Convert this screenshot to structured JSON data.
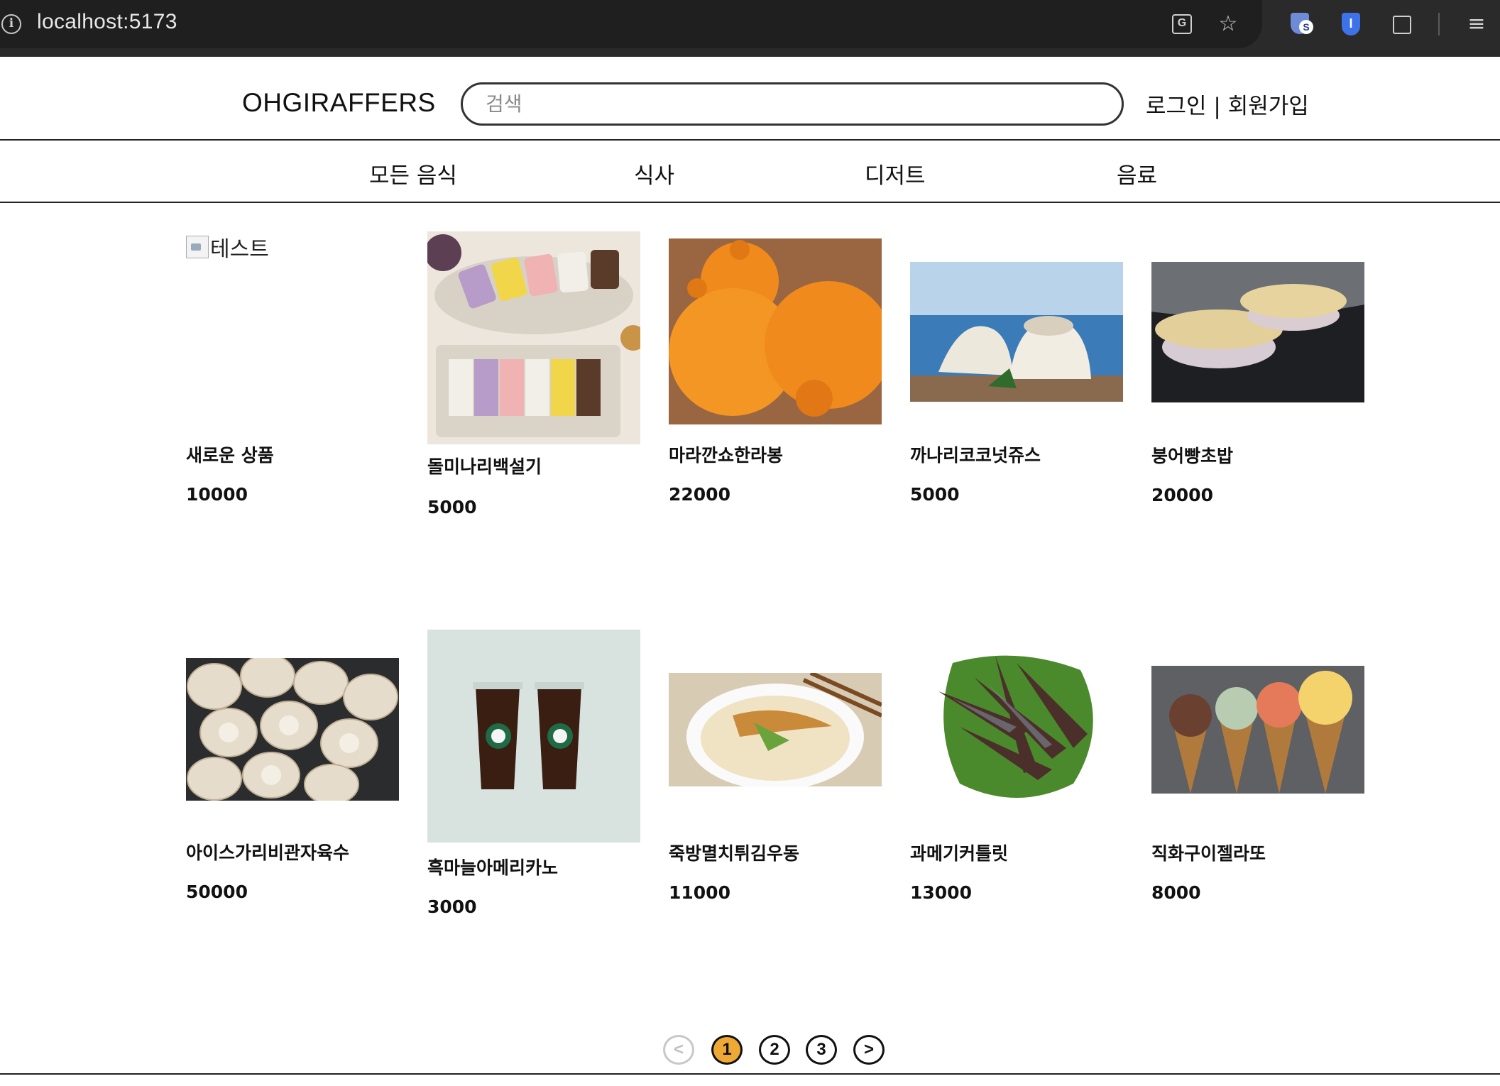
{
  "browser": {
    "url": "localhost:5173",
    "icons": [
      "info-icon",
      "translate-icon",
      "star-icon",
      "shield-extension-icon",
      "bitwarden-icon",
      "puzzle-icon",
      "queue-icon"
    ]
  },
  "header": {
    "logo": "OHGIRAFFERS",
    "search_placeholder": "검색",
    "login": "로그인",
    "separator": " | ",
    "signup": "회원가입"
  },
  "categories": [
    "모든 음식",
    "식사",
    "디저트",
    "음료"
  ],
  "products": [
    {
      "name": "새로운 상품",
      "price": "10000",
      "image_alt": "테스트",
      "image": "broken-image"
    },
    {
      "name": "돌미나리백설기",
      "price": "5000",
      "image": "rice-cake-photo"
    },
    {
      "name": "마라깐쇼한라봉",
      "price": "22000",
      "image": "hallabong-orange-photo"
    },
    {
      "name": "까나리코코넛쥬스",
      "price": "5000",
      "image": "coconut-photo"
    },
    {
      "name": "붕어빵초밥",
      "price": "20000",
      "image": "fish-bread-sushi-photo"
    },
    {
      "name": "아이스가리비관자육수",
      "price": "50000",
      "image": "scallop-photo"
    },
    {
      "name": "흑마늘아메리카노",
      "price": "3000",
      "image": "iced-americano-photo"
    },
    {
      "name": "죽방멸치튀김우동",
      "price": "11000",
      "image": "tempura-udon-photo"
    },
    {
      "name": "과메기커틀릿",
      "price": "13000",
      "image": "gwamegi-photo"
    },
    {
      "name": "직화구이젤라또",
      "price": "8000",
      "image": "gelato-cones-photo"
    }
  ],
  "pagination": {
    "prev": "<",
    "pages": [
      "1",
      "2",
      "3"
    ],
    "current": "1",
    "next": ">"
  },
  "colors": {
    "accent": "#eea935",
    "border": "#222222"
  }
}
